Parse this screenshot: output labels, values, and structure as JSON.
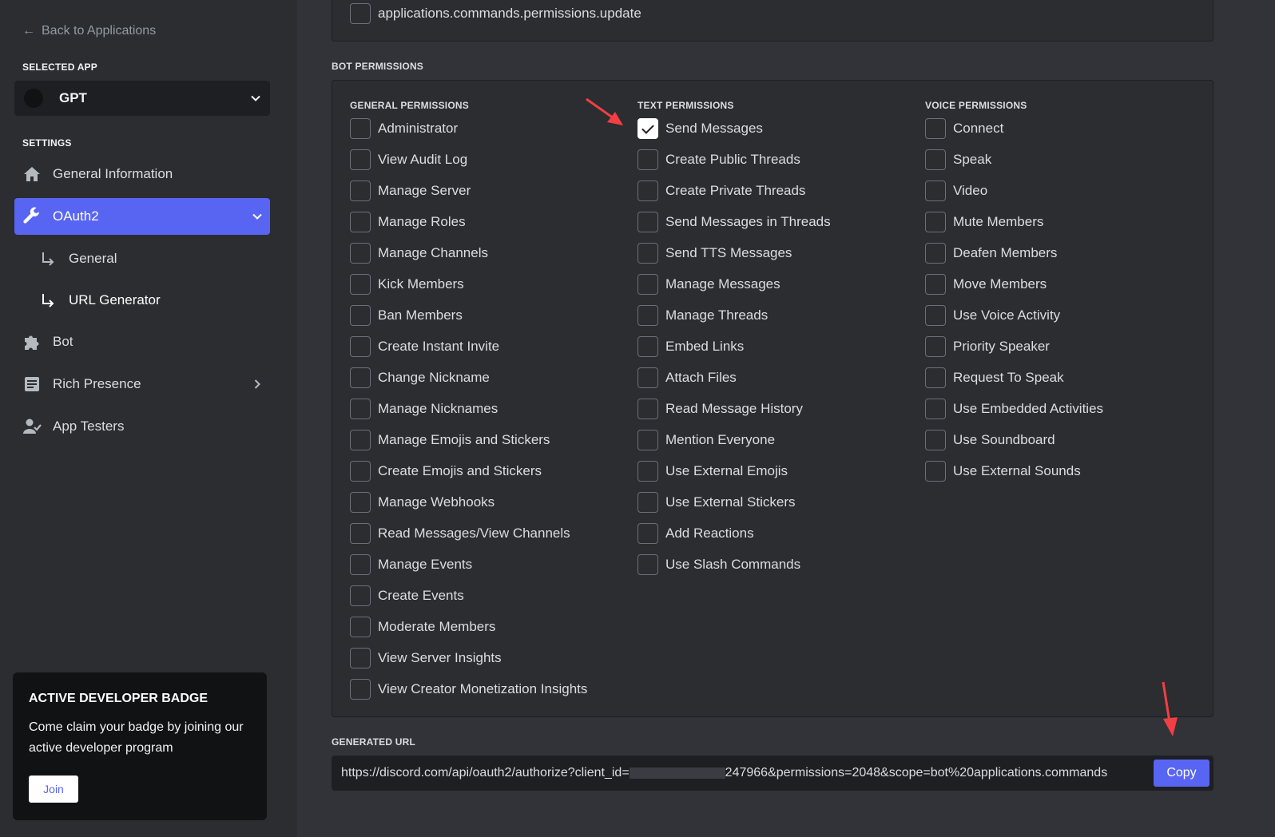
{
  "sidebar": {
    "back_label": "Back to Applications",
    "selected_app_heading": "SELECTED APP",
    "app_name": "GPT",
    "settings_heading": "SETTINGS",
    "nav": {
      "general_information": "General Information",
      "oauth2": "OAuth2",
      "general": "General",
      "url_generator": "URL Generator",
      "bot": "Bot",
      "rich_presence": "Rich Presence",
      "app_testers": "App Testers"
    },
    "badge": {
      "title": "ACTIVE DEVELOPER BADGE",
      "text": "Come claim your badge by joining our active developer program",
      "join_label": "Join"
    }
  },
  "scopes": {
    "last_scope": "applications.commands.permissions.update"
  },
  "bot_permissions": {
    "heading": "BOT PERMISSIONS",
    "general": {
      "heading": "GENERAL PERMISSIONS",
      "items": [
        "Administrator",
        "View Audit Log",
        "Manage Server",
        "Manage Roles",
        "Manage Channels",
        "Kick Members",
        "Ban Members",
        "Create Instant Invite",
        "Change Nickname",
        "Manage Nicknames",
        "Manage Emojis and Stickers",
        "Create Emojis and Stickers",
        "Manage Webhooks",
        "Read Messages/View Channels",
        "Manage Events",
        "Create Events",
        "Moderate Members",
        "View Server Insights",
        "View Creator Monetization Insights"
      ]
    },
    "text": {
      "heading": "TEXT PERMISSIONS",
      "items": [
        "Send Messages",
        "Create Public Threads",
        "Create Private Threads",
        "Send Messages in Threads",
        "Send TTS Messages",
        "Manage Messages",
        "Manage Threads",
        "Embed Links",
        "Attach Files",
        "Read Message History",
        "Mention Everyone",
        "Use External Emojis",
        "Use External Stickers",
        "Add Reactions",
        "Use Slash Commands"
      ],
      "checked": [
        "Send Messages"
      ]
    },
    "voice": {
      "heading": "VOICE PERMISSIONS",
      "items": [
        "Connect",
        "Speak",
        "Video",
        "Mute Members",
        "Deafen Members",
        "Move Members",
        "Use Voice Activity",
        "Priority Speaker",
        "Request To Speak",
        "Use Embedded Activities",
        "Use Soundboard",
        "Use External Sounds"
      ]
    }
  },
  "generated_url": {
    "heading": "GENERATED URL",
    "url_prefix": "https://discord.com/api/oauth2/authorize?client_id=",
    "url_suffix": "247966&permissions=2048&scope=bot%20applications.commands",
    "copy_label": "Copy"
  },
  "colors": {
    "accent": "#5865f2",
    "annotation_arrow": "#f23f43"
  }
}
